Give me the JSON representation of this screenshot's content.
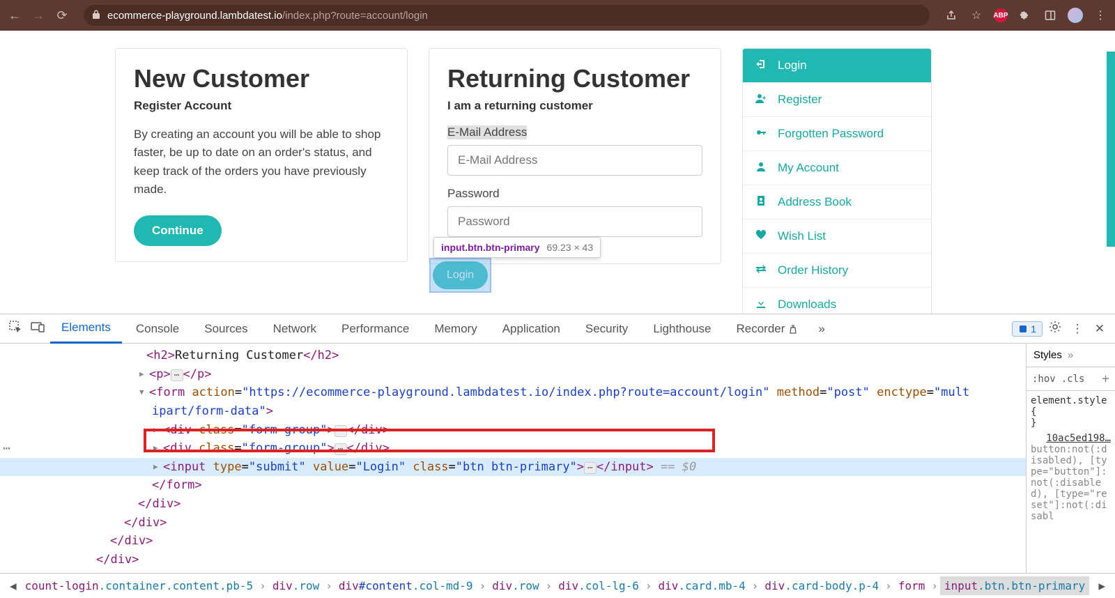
{
  "browser": {
    "url_domain": "ecommerce-playground.lambdatest.io",
    "url_path": "/index.php?route=account/login"
  },
  "new_customer": {
    "title": "New Customer",
    "subtitle": "Register Account",
    "body": "By creating an account you will be able to shop faster, be up to date on an order's status, and keep track of the orders you have previously made.",
    "continue": "Continue"
  },
  "returning": {
    "title": "Returning Customer",
    "subtitle": "I am a returning customer",
    "email_label": "E-Mail Address",
    "email_placeholder": "E-Mail Address",
    "password_label": "Password",
    "password_placeholder": "Password",
    "login": "Login"
  },
  "inspect": {
    "selector": "input.btn.btn-primary",
    "dims": "69.23 × 43"
  },
  "sidebar": [
    {
      "icon": "login",
      "label": "Login"
    },
    {
      "icon": "register",
      "label": "Register"
    },
    {
      "icon": "key",
      "label": "Forgotten Password"
    },
    {
      "icon": "user",
      "label": "My Account"
    },
    {
      "icon": "addr",
      "label": "Address Book"
    },
    {
      "icon": "heart",
      "label": "Wish List"
    },
    {
      "icon": "swap",
      "label": "Order History"
    },
    {
      "icon": "download",
      "label": "Downloads"
    }
  ],
  "devtools": {
    "tabs": [
      "Elements",
      "Console",
      "Sources",
      "Network",
      "Performance",
      "Memory",
      "Application",
      "Security",
      "Lighthouse",
      "Recorder"
    ],
    "active_tab": "Elements",
    "issue_count": "1",
    "styles": {
      "title": "Styles",
      "hov": ":hov",
      "cls": ".cls",
      "elem": "element.style {",
      "brace": "}",
      "link": "10ac5ed198…",
      "rule": "button:not(:disabled), [type=\"button\"]:not(:disabled), [type=\"reset\"]:not(:disabl"
    },
    "dom": {
      "line0": "<h2>Returning Customer</h2>",
      "line1_open": "<p>",
      "line1_close": "</p>",
      "form_open_1": "<form action=\"https://ecommerce-playground.lambdatest.io/index.php?route=account/login\" method=\"post\" enctype=\"mult",
      "form_open_2": "ipart/form-data\">",
      "div_fg_open": "<div class=\"form-group\">",
      "div_fg_close": "</div>",
      "input_open": "<input type=\"submit\" value=\"Login\" class=\"btn btn-primary\">",
      "input_close": "</input>",
      "eq0": " == $0",
      "form_close": "</form>",
      "div_close": "</div>"
    },
    "breadcrumb": [
      {
        "raw": "count-login",
        "tag": "",
        "cls": ".container.content.pb-5"
      },
      {
        "tag": "div",
        "cls": ".row"
      },
      {
        "tag": "div",
        "id": "#content",
        "cls": ".col-md-9"
      },
      {
        "tag": "div",
        "cls": ".row"
      },
      {
        "tag": "div",
        "cls": ".col-lg-6"
      },
      {
        "tag": "div",
        "cls": ".card.mb-4"
      },
      {
        "tag": "div",
        "cls": ".card-body.p-4"
      },
      {
        "tag": "form",
        "cls": ""
      },
      {
        "tag": "input",
        "cls": ".btn.btn-primary",
        "active": true
      }
    ]
  }
}
